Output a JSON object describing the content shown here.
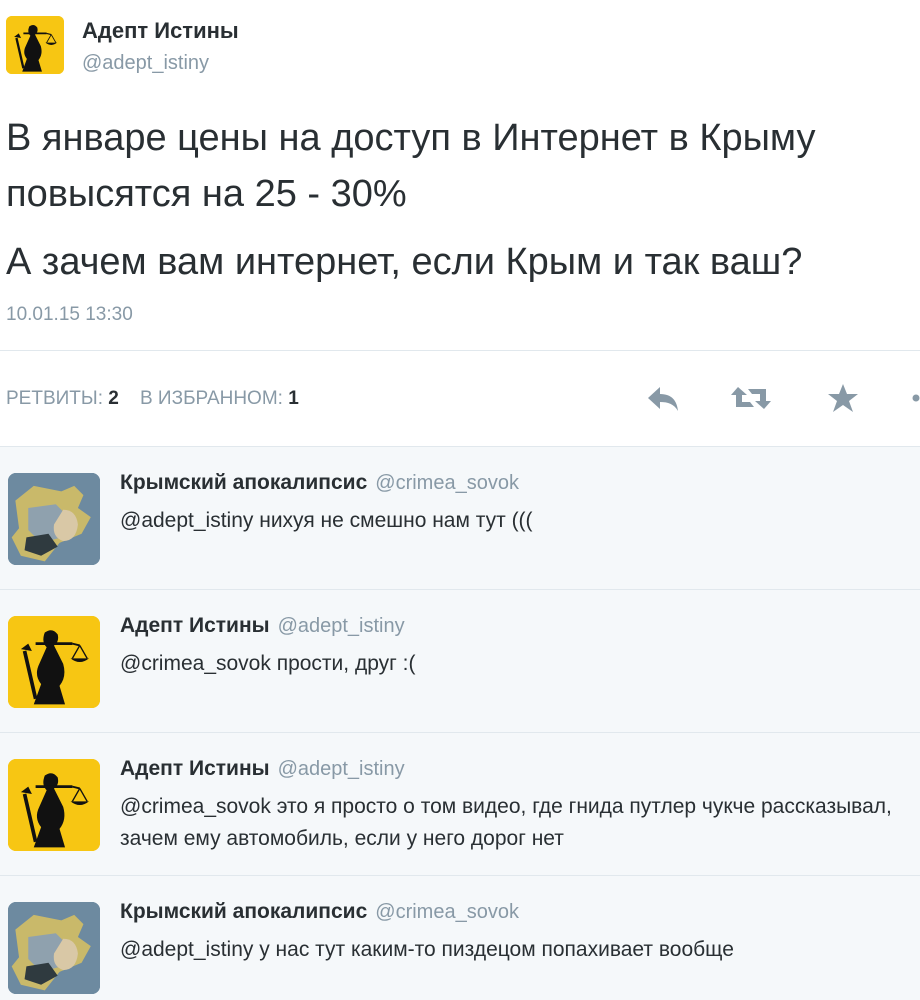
{
  "main_tweet": {
    "author_name": "Адепт Истины",
    "author_handle": "@adept_istiny",
    "text_line1": "В январе цены на доступ в Интернет в Крыму повысятся на 25 - 30%",
    "text_line2": "А зачем вам интернет, если Крым и так ваш?",
    "date": "10.01.15 13:30",
    "retweets_label": "РЕТВИТЫ:",
    "retweets_count": "2",
    "favorites_label": "В ИЗБРАННОМ:",
    "favorites_count": "1",
    "actions": [
      "reply-icon",
      "retweet-icon",
      "favorite-icon",
      "more-icon"
    ]
  },
  "replies": [
    {
      "name": "Крымский апокалипсис",
      "handle": "@crimea_sovok",
      "text": "@adept_istiny нихуя не смешно нам тут (((",
      "avatar": "crimea-map-avatar"
    },
    {
      "name": "Адепт Истины",
      "handle": "@adept_istiny",
      "text": "@crimea_sovok прости, друг :(",
      "avatar": "lady-justice-avatar"
    },
    {
      "name": "Адепт Истины",
      "handle": "@adept_istiny",
      "text": "@crimea_sovok это я просто о том видео, где гнида путлер чукче рассказывал, зачем ему автомобиль, если у него дорог нет",
      "avatar": "lady-justice-avatar"
    },
    {
      "name": "Крымский апокалипсис",
      "handle": "@crimea_sovok",
      "text": "@adept_istiny у нас тут каким-то пиздецом попахивает вообще",
      "avatar": "crimea-map-avatar"
    }
  ],
  "colors": {
    "text": "#292f33",
    "muted": "#8899a6",
    "avatar_yellow": "#f7c613",
    "reply_bg": "#f5f8fa",
    "divider": "#e1e8ed"
  }
}
